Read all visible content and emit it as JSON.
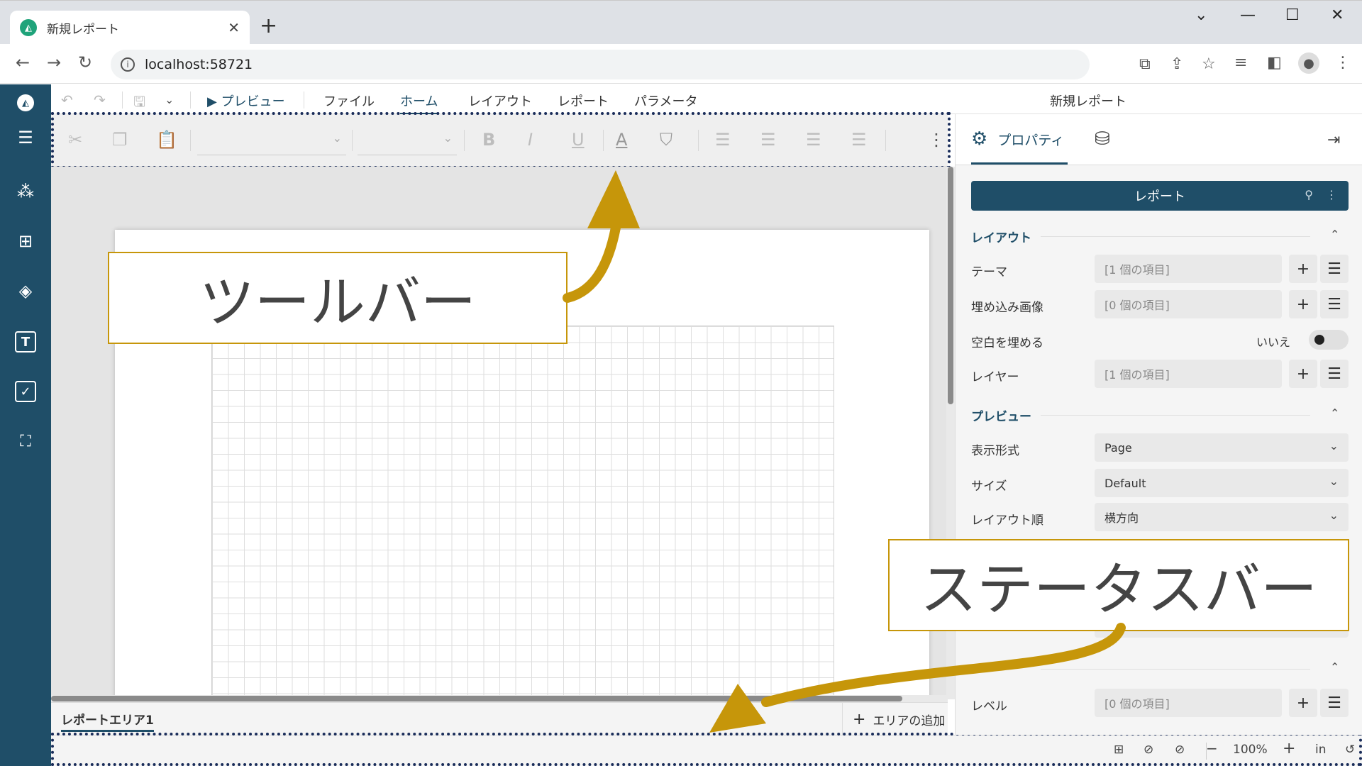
{
  "browser": {
    "tab_title": "新規レポート",
    "url": "localhost:58721"
  },
  "menubar": {
    "preview": "プレビュー",
    "items": [
      "ファイル",
      "ホーム",
      "レイアウト",
      "レポート",
      "パラメータ"
    ],
    "active": "ホーム",
    "doc_title": "新規レポート"
  },
  "canvas": {
    "area_tab": "レポートエリア1",
    "add_area": "エリアの追加"
  },
  "statusbar": {
    "zoom": "100%",
    "unit": "in"
  },
  "panel": {
    "tab_properties": "プロパティ",
    "header": "レポート",
    "section_layout": "レイアウト",
    "theme_label": "テーマ",
    "theme_value": "[1 個の項目]",
    "embedded_images_label": "埋め込み画像",
    "embedded_images_value": "[0 個の項目]",
    "fill_blank_label": "空白を埋める",
    "fill_blank_value": "いいえ",
    "layers_label": "レイヤー",
    "layers_value": "[1 個の項目]",
    "section_preview": "プレビュー",
    "display_format_label": "表示形式",
    "display_format_value": "Page",
    "size_label": "サイズ",
    "size_value": "Default",
    "layout_order_label": "レイアウト順",
    "layout_order_value": "横方向",
    "level_label": "レベル",
    "level_value": "[0 個の項目]"
  },
  "callouts": {
    "toolbar": "ツールバー",
    "statusbar": "ステータスバー"
  },
  "colors": {
    "accent": "#1f4e68",
    "callout_border": "#c6960a",
    "arrow": "#c6960a",
    "dotted": "#1a2d5a"
  }
}
